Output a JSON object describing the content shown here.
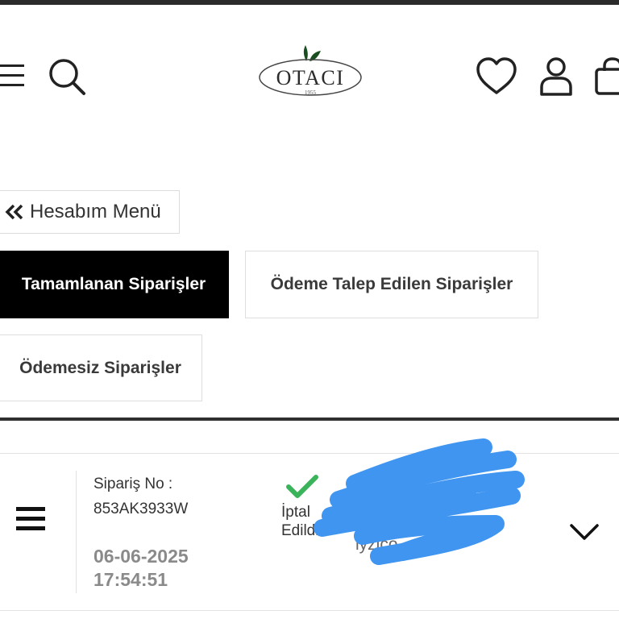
{
  "header": {
    "logo_text": "OTACI",
    "logo_year": "1955",
    "icons": [
      "hamburger-menu-icon",
      "search-icon",
      "heart-icon",
      "user-icon",
      "shopping-bag-icon"
    ]
  },
  "account_menu": {
    "label": "Hesabım Menü"
  },
  "tabs": [
    {
      "label": "Tamamlanan Siparişler",
      "active": true
    },
    {
      "label": "Ödeme Talep Edilen Siparişler",
      "active": false
    },
    {
      "label": "Ödemesiz Siparişler",
      "active": false
    }
  ],
  "order": {
    "number_label": "Sipariş No :",
    "number": "853AK3933W",
    "date": "06-06-2025",
    "time": "17:54:51",
    "status_line1": "İptal",
    "status_line2": "Edildi",
    "payment_partial": "iyzico",
    "status_color": "#3bb35a",
    "redaction_color": "#3f95f0"
  }
}
